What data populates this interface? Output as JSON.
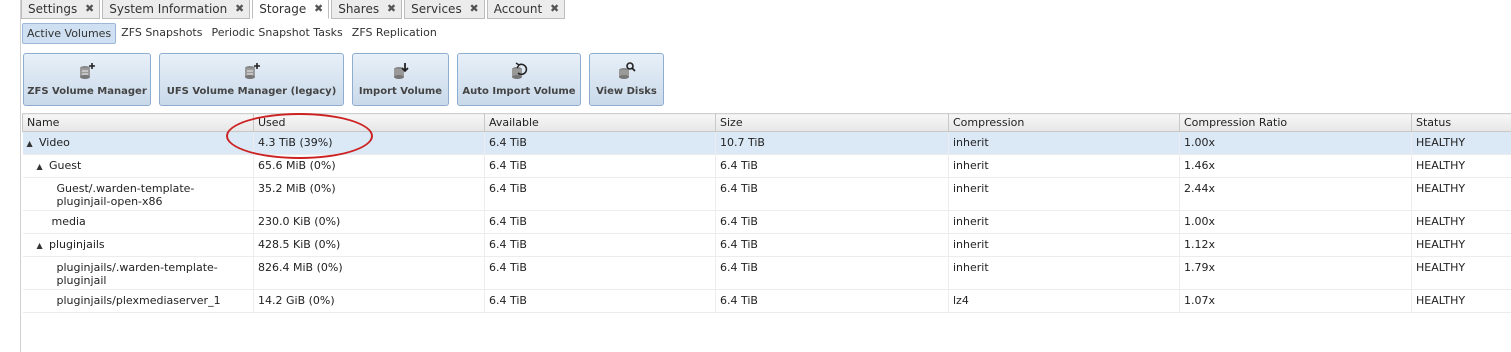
{
  "tabs": [
    {
      "label": "Settings",
      "active": false
    },
    {
      "label": "System Information",
      "active": false
    },
    {
      "label": "Storage",
      "active": true
    },
    {
      "label": "Shares",
      "active": false
    },
    {
      "label": "Services",
      "active": false
    },
    {
      "label": "Account",
      "active": false
    }
  ],
  "subtabs": [
    {
      "label": "Active Volumes",
      "active": true
    },
    {
      "label": "ZFS Snapshots",
      "active": false
    },
    {
      "label": "Periodic Snapshot Tasks",
      "active": false
    },
    {
      "label": "ZFS Replication",
      "active": false
    }
  ],
  "toolbar": [
    {
      "label": "ZFS Volume Manager",
      "icon": "database-add-icon"
    },
    {
      "label": "UFS Volume Manager (legacy)",
      "icon": "database-add-icon"
    },
    {
      "label": "Import Volume",
      "icon": "database-import-icon"
    },
    {
      "label": "Auto Import Volume",
      "icon": "database-auto-import-icon"
    },
    {
      "label": "View Disks",
      "icon": "disk-search-icon"
    }
  ],
  "grid": {
    "columns": [
      "Name",
      "Used",
      "Available",
      "Size",
      "Compression",
      "Compression Ratio",
      "Status"
    ],
    "rows": [
      {
        "name": "Video",
        "expander": "▲",
        "used": "4.3 TiB (39%)",
        "available": "6.4 TiB",
        "size": "10.7 TiB",
        "compression": "inherit",
        "ratio": "1.00x",
        "status": "HEALTHY"
      },
      {
        "name": "Guest",
        "expander": "▲",
        "used": "65.6 MiB (0%)",
        "available": "6.4 TiB",
        "size": "6.4 TiB",
        "compression": "inherit",
        "ratio": "1.46x",
        "status": "HEALTHY"
      },
      {
        "name": "Guest/.warden-template-pluginjail-open-x86",
        "name_line1": "Guest/.warden-template-",
        "name_line2": "pluginjail-open-x86",
        "used": "35.2 MiB (0%)",
        "available": "6.4 TiB",
        "size": "6.4 TiB",
        "compression": "inherit",
        "ratio": "2.44x",
        "status": "HEALTHY"
      },
      {
        "name": "media",
        "used": "230.0 KiB (0%)",
        "available": "6.4 TiB",
        "size": "6.4 TiB",
        "compression": "inherit",
        "ratio": "1.00x",
        "status": "HEALTHY"
      },
      {
        "name": "pluginjails",
        "expander": "▲",
        "used": "428.5 KiB (0%)",
        "available": "6.4 TiB",
        "size": "6.4 TiB",
        "compression": "inherit",
        "ratio": "1.12x",
        "status": "HEALTHY"
      },
      {
        "name": "pluginjails/.warden-template-pluginjail",
        "name_line1": "pluginjails/.warden-template-",
        "name_line2": "pluginjail",
        "used": "826.4 MiB (0%)",
        "available": "6.4 TiB",
        "size": "6.4 TiB",
        "compression": "inherit",
        "ratio": "1.79x",
        "status": "HEALTHY"
      },
      {
        "name": "pluginjails/plexmediaserver_1",
        "used": "14.2 GiB (0%)",
        "available": "6.4 TiB",
        "size": "6.4 TiB",
        "compression": "lz4",
        "ratio": "1.07x",
        "status": "HEALTHY"
      }
    ]
  },
  "close_glyph": "✖"
}
